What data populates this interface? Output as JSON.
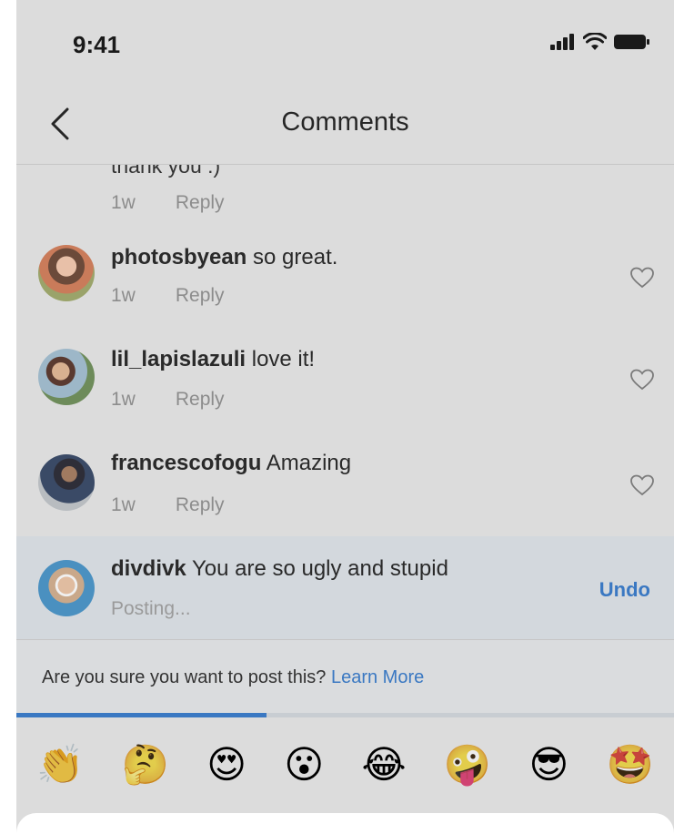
{
  "status_bar": {
    "time": "9:41"
  },
  "nav": {
    "title": "Comments"
  },
  "partial_comment": {
    "text": "thank you :)",
    "time": "1w",
    "reply": "Reply"
  },
  "comments": [
    {
      "user": "photosbyean",
      "text": "so great.",
      "time": "1w",
      "reply": "Reply"
    },
    {
      "user": "lil_lapislazuli",
      "text": "love it!",
      "time": "1w",
      "reply": "Reply"
    },
    {
      "user": "francescofogu",
      "text": "Amazing",
      "time": "1w",
      "reply": "Reply"
    }
  ],
  "pending": {
    "user": "divdivk",
    "text": "You are so ugly and stupid",
    "status": "Posting...",
    "undo": "Undo"
  },
  "warning": {
    "text": "Are you sure you want to post this?",
    "link": "Learn More"
  },
  "progress": {
    "fraction": 0.38
  },
  "emojis": [
    "👏",
    "🤔",
    "😍",
    "😮",
    "😂",
    "🤪",
    "😎",
    "🤩"
  ],
  "colors": {
    "accent": "#3a78c2",
    "overlay": "#dcdcdc",
    "pending_bg": "#d3d8dd"
  }
}
